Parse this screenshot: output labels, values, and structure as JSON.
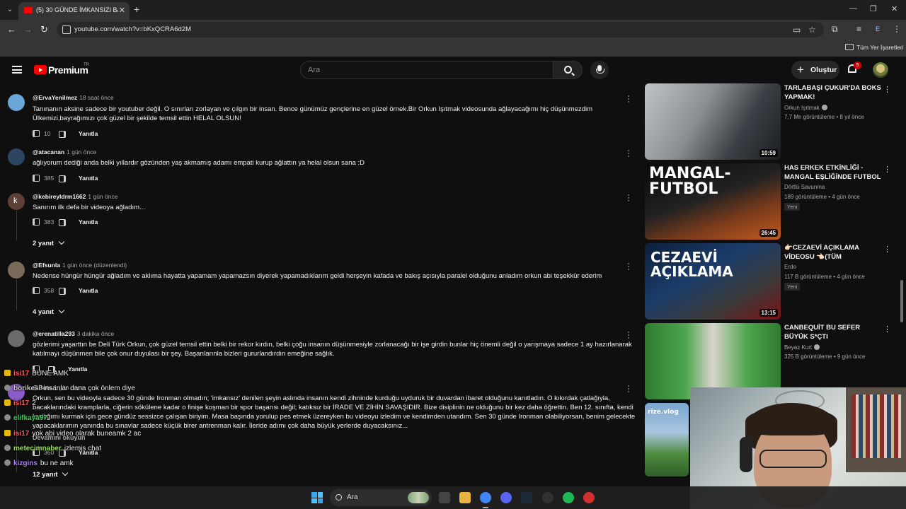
{
  "browser": {
    "tab_title": "(5) 30 GÜNDE İMKANSIZI BAŞAR",
    "url": "youtube.com/watch?v=bKxQCRA6d2M",
    "profile_initial": "E",
    "bookmarks_label": "Tüm Yer İşaretleri"
  },
  "masthead": {
    "brand": "Premium",
    "country": "TR",
    "search_placeholder": "Ara",
    "create_label": "Oluştur",
    "notification_count": "5"
  },
  "comments": [
    {
      "author": "@ErvaYenilmez",
      "time": "18 saat önce",
      "text": "Tanınanın aksine sadece bir youtuber değil. O sınırları zorlayan ve çılgın bir insan. Bence günümüz gençlerine en güzel örnek.Bir Orkun Işıtmak videosunda ağlayacağımı hiç düşünmezdim Ülkemizi,bayrağımızı çok güzel bir şekilde temsil ettin HELAL OLSUN!",
      "likes": "10",
      "reply_label": "Yanıtla",
      "avatar_color": "#6aa6d8"
    },
    {
      "author": "@atacanan",
      "time": "1 gün önce",
      "text": "ağlıyorum dediği anda belki yıllardır gözünden yaş akmamış adamı empati kurup ağlattın ya helal olsun sana :D",
      "likes": "385",
      "reply_label": "Yanıtla",
      "avatar_color": "#2c4560"
    },
    {
      "author": "@kebireyldrm1662",
      "time": "1 gün önce",
      "text": "Sanırım ilk defa bir videoya ağladım...",
      "likes": "383",
      "reply_label": "Yanıtla",
      "avatar_color": "#5d4037",
      "avatar_letter": "k",
      "replies": "2 yanıt"
    },
    {
      "author": "@Efsunla",
      "time": "1 gün önce (düzenlendi)",
      "text": "Nedense hüngür hüngür ağladım ve aklıma hayatta yapamam yapamazsın diyerek yapamadıklarım geldi herşeyin kafada ve bakış açısıyla paralel olduğunu anladım orkun abi teşekkür ederim",
      "likes": "358",
      "reply_label": "Yanıtla",
      "avatar_color": "#7a6a5a",
      "replies": "4 yanıt"
    },
    {
      "author": "@erenatilla293",
      "time": "3 dakika önce",
      "text": "gözlerimi yaşarttın be Deli Türk Orkun, çok güzel temsil ettin belki bir rekor kırdın, belki çoğu insanın düşünmesiyle zorlanacağı bir işe girdin bunlar hiç önemli değil o yarışmaya sadece 1 ay hazırlanarak katılmayı düşünmen bile çok onur duyulası bir şey. Başarılarınla bizleri gururlandırdın emeğine sağlık.",
      "likes": "",
      "reply_label": "Yanıtla",
      "avatar_color": "#6b6b6b"
    },
    {
      "author": "@Batu",
      "time": "1 gün önce",
      "text": "Orkun, sen bu videoyla sadece 30 günde Ironman olmadın; 'imkansız' denilen şeyin aslında insanın kendi zihninde kurduğu uyduruk bir duvardan ibaret olduğunu kanıtladın. O kıkırdak çatlağıyla, bacaklarındaki kramplarla, ciğerin sökülene kadar o finişe koşman bir spor başarısı değil; katıksız bir İRADE VE ZİHİN SAVAŞIDIR. Bize disiplinin ne olduğunu bir kez daha öğrettin. Ben 12. sınıfta, kendi krallığımı kurmak için gece gündüz sessizce çalışan biriyim. Masa başında yorulup pes etmek üzereyken bu videoyu izledim ve kendimden utandım. Sen 30 günde Ironman olabiliyorsan, benim gelecekte yapacaklarımın yanında bu sınavlar sadece küçük birer antrenman kalır. İleride adımı çok daha büyük yerlerde duyacaksınız...",
      "read_more": "Devamını okuyun",
      "likes": "360",
      "reply_label": "Yanıtla",
      "avatar_color": "#8a5cc7",
      "replies": "12 yanıt"
    }
  ],
  "recommendations": [
    {
      "title": "TARLABAŞI ÇUKUR'DA BOKS YAPMAK!",
      "channel": "Orkun Işıtmak",
      "verified": true,
      "meta": "7,7 Mn görüntüleme • 8 yıl önce",
      "duration": "10:59",
      "badge": ""
    },
    {
      "title": "HAS ERKEK ETKİNLİĞİ - MANGAL EŞLİĞİNDE FUTBOL ...",
      "channel": "Dörtlü Savunma",
      "verified": false,
      "meta": "189 görüntüleme • 4 gün önce",
      "duration": "26:45",
      "badge": "Yeni",
      "thumb_text": "MANGAL- FUTBOL"
    },
    {
      "title": "👉🏻CEZAEVİ AÇIKLAMA VİDEOSU 👈🏻(TÜM GERÇEKLE...",
      "channel": "Erdo",
      "verified": false,
      "meta": "117 B görüntüleme • 4 gün önce",
      "duration": "13:15",
      "badge": "Yeni",
      "thumb_text": "CEZAEVİ AÇIKLAMA"
    },
    {
      "title": "CANBEQUİT BU SEFER BÜYÜK S*ÇTI",
      "channel": "Beyaz Kurt",
      "verified": true,
      "meta": "325 B görüntüleme • 9 gün önce",
      "duration": "",
      "badge": ""
    },
    {
      "title": "",
      "channel": "",
      "verified": false,
      "meta": "",
      "duration": "",
      "badge": "",
      "thumb_text": "rize.vlog"
    }
  ],
  "chat": [
    {
      "user": "isi17",
      "message": "BUNE AMK",
      "color": "#ff5a5a",
      "badge": true
    },
    {
      "user": "borikesi",
      "message": "insanlar dana çok önlem diye",
      "color": "#c0c0c0",
      "badge": false
    },
    {
      "user": "isi17",
      "message": "2",
      "color": "#ff5a5a",
      "badge": true
    },
    {
      "user": "elifkaya97",
      "message": "",
      "color": "#3ccf4e",
      "badge": false
    },
    {
      "user": "isi17",
      "message": "yok abi video olarak buneamk 2 ac",
      "color": "#ff5a5a",
      "badge": true
    },
    {
      "user": "metecimnaber",
      "message": "izlemiş chat",
      "color": "#9adf60",
      "badge": false
    },
    {
      "user": "kizgins",
      "message": "bu ne amk",
      "color": "#b07dff",
      "badge": false
    }
  ],
  "taskbar": {
    "search_label": "Ara",
    "apps": [
      "explorer-icon",
      "folder-icon",
      "chrome-icon",
      "discord-icon",
      "steam-icon",
      "obs-icon",
      "spotify-icon",
      "app-red-icon"
    ]
  }
}
